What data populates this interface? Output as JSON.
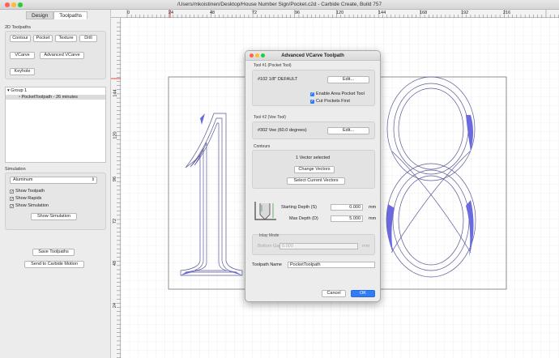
{
  "window": {
    "title": "/Users/mkoistinen/Desktop/House Number Sign/Pocket.c2d - Carbide Create, Build 757"
  },
  "sidebar": {
    "tabs": [
      {
        "label": "Design"
      },
      {
        "label": "Toolpaths"
      }
    ],
    "section_2d": "2D Toolpaths",
    "buttons": {
      "contour": "Contour",
      "pocket": "Pocket",
      "texture": "Texture",
      "drill": "Drill",
      "vcarve": "VCarve",
      "advanced_vcarve": "Advanced VCarve",
      "keyhole": "Keyhole"
    },
    "tree": {
      "group": "Group 1",
      "item": "PocketToolpath - 26 minutes"
    },
    "simulation": {
      "label": "Simulation",
      "material": "Aluminum",
      "checks": [
        {
          "label": "Show Toolpath"
        },
        {
          "label": "Show Rapids"
        },
        {
          "label": "Show Simulation"
        }
      ],
      "show_button": "Show Simulation"
    },
    "save_button": "Save Toolpaths",
    "send_button": "Send to Carbide Motion"
  },
  "rulers": {
    "top": [
      "0",
      "24",
      "48",
      "72",
      "96",
      "120",
      "144",
      "168",
      "192",
      "216"
    ],
    "left": [
      "144",
      "120",
      "96",
      "72",
      "48",
      "24"
    ]
  },
  "dialog": {
    "title": "Advanced VCarve Toolpath",
    "tool1": {
      "label": "Tool #1 (Pocket Tool)",
      "name": "#102 1/8\" DEFAULT",
      "edit": "Edit...",
      "enable_area": "Enable Area Pocket Tool",
      "cut_first": "Cut Pockets First"
    },
    "tool2": {
      "label": "Tool #2 (Vee Tool)",
      "name": "#302 Vee (60.0 degrees)",
      "edit": "Edit..."
    },
    "contours": {
      "label": "Contours",
      "status": "1 Vector selected",
      "change": "Change Vectors",
      "select": "Select Current Vectors"
    },
    "depth": {
      "start_label": "Starting Depth (S)",
      "start_value": "0.000",
      "max_label": "Max Depth (D)",
      "max_value": "5.000",
      "unit": "mm"
    },
    "inlay": {
      "label": "Inlay Mode",
      "bottom_gap_label": "Bottom Gap",
      "bottom_gap_value": "0.000",
      "unit": "mm"
    },
    "toolpath_name_label": "Toolpath Name",
    "toolpath_name_value": "PocketToolpath",
    "cancel": "Cancel",
    "ok": "OK"
  }
}
